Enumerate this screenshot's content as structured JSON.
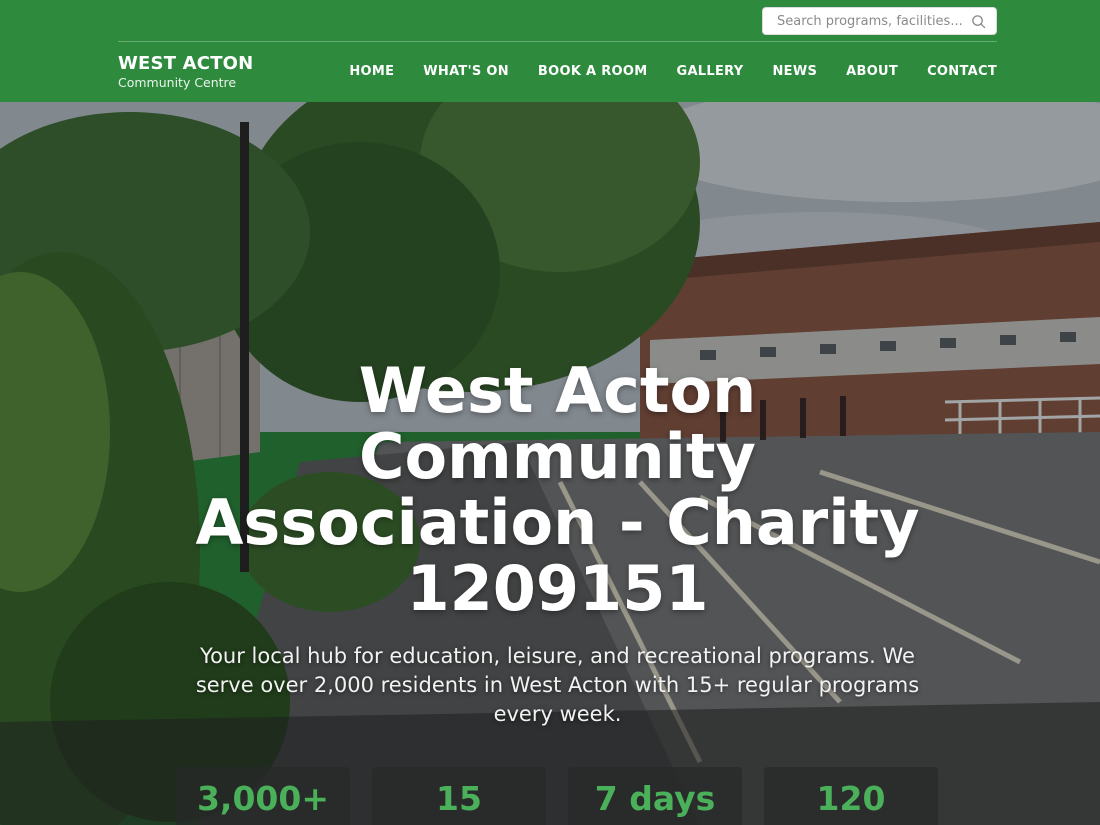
{
  "brand": {
    "name": "WEST ACTON",
    "subtitle": "Community Centre"
  },
  "search": {
    "placeholder": "Search programs, facilities...",
    "icon": "search-icon"
  },
  "nav": [
    {
      "label": "HOME"
    },
    {
      "label": "WHAT'S ON"
    },
    {
      "label": "BOOK A ROOM"
    },
    {
      "label": "GALLERY"
    },
    {
      "label": "NEWS"
    },
    {
      "label": "ABOUT"
    },
    {
      "label": "CONTACT"
    }
  ],
  "hero": {
    "title": "West Acton Community Association - Charity 1209151",
    "text": "Your local hub for education, leisure, and recreational programs. We serve over 2,000 residents in West Acton with 15+ regular programs every week."
  },
  "stats": [
    {
      "value": "3,000+"
    },
    {
      "value": "15"
    },
    {
      "value": "7 days"
    },
    {
      "value": "120"
    }
  ],
  "colors": {
    "header": "#2e8b3e",
    "accent": "#4bb05a"
  }
}
